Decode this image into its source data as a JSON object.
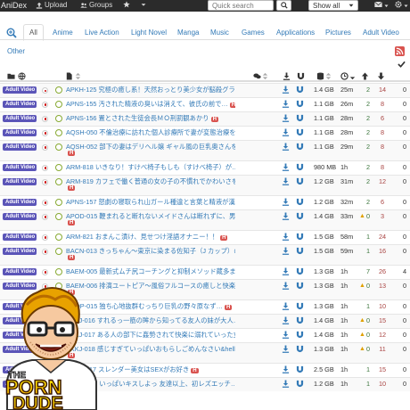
{
  "nav": {
    "brand": "AniDex",
    "upload": "Upload",
    "groups": "Groups",
    "search_placeholder": "Quick search",
    "select_value": "Show all"
  },
  "tabs": [
    "All",
    "Anime",
    "Live Action",
    "Light Novel",
    "Manga",
    "Music",
    "Games",
    "Applications",
    "Pictures",
    "Adult Video",
    "Other"
  ],
  "overlay": {
    "line1": "THE",
    "line2": "PORN",
    "line3": "DUDE"
  },
  "rows": [
    {
      "badge": "Adult Video",
      "title": "APKH-125 究極の癒し系！天然おっとり美少女が脳殺グラ・",
      "h_inline": true,
      "size": "1.4 GB",
      "age": "25m",
      "seeders": "2",
      "leechers": "14",
      "completed": "0",
      "tall": false,
      "warn": false
    },
    {
      "badge": "Adult Video",
      "title": "APNS-155 汚された精液の臭いは消えて、彼氏の前で…",
      "h_inline": true,
      "size": "1.1 GB",
      "age": "26m",
      "seeders": "2",
      "leechers": "8",
      "completed": "0",
      "tall": false,
      "warn": false
    },
    {
      "badge": "Adult Video",
      "title": "APNS-156 置とされた生徒会長ＭＯ刑罰観あかり",
      "h_inline": true,
      "size": "1.1 GB",
      "age": "28m",
      "seeders": "2",
      "leechers": "6",
      "completed": "0",
      "tall": false,
      "warn": false
    },
    {
      "badge": "Adult Video",
      "title": "AQSH-050 不倫治療に訪れた個人診療所で妻が変態治療を…",
      "h_inline": true,
      "size": "1.1 GB",
      "age": "28m",
      "seeders": "2",
      "leechers": "8",
      "completed": "0",
      "tall": false,
      "warn": false
    },
    {
      "badge": "Adult Video",
      "title": "AQSH-052 部下の妻はデリヘル嬢 ギャル風の巨乳奥さんを…",
      "h_inline": false,
      "size": "1.1 GB",
      "age": "29m",
      "seeders": "2",
      "leechers": "8",
      "completed": "0",
      "tall": true,
      "warn": false
    },
    {
      "badge": "Adult Video",
      "title": "ARM-818 いきなり！すけべ椅子もしも（すけべ椅子）が…",
      "h_inline": true,
      "size": "980 MB",
      "age": "1h",
      "seeders": "2",
      "leechers": "8",
      "completed": "0",
      "tall": false,
      "warn": false
    },
    {
      "badge": "Adult Video",
      "title": "ARM-819 カフェで働く普通の女の子の不慣れでかわいさを…",
      "h_inline": false,
      "size": "1.2 GB",
      "age": "31m",
      "seeders": "2",
      "leechers": "12",
      "completed": "0",
      "tall": true,
      "warn": false
    },
    {
      "badge": "Adult Video",
      "title": "APNS-157 怒劇の寝取られ山ガール種違と言葉と精液が漢…",
      "h_inline": true,
      "size": "1.2 GB",
      "age": "32m",
      "seeders": "2",
      "leechers": "6",
      "completed": "0",
      "tall": false,
      "warn": false
    },
    {
      "badge": "Adult Video",
      "title": "APOD-015 鞭まれると断れないメイドさんは断れずに、男…",
      "h_inline": false,
      "size": "1.4 GB",
      "age": "33m",
      "seeders": "0",
      "leechers": "3",
      "completed": "0",
      "tall": true,
      "warn": true
    },
    {
      "badge": "Adult Video",
      "title": "ARM-821 おまんこ漬け、見せつけ淫語オナニー！！",
      "h_inline": true,
      "size": "1.5 GB",
      "age": "58m",
      "seeders": "1",
      "leechers": "24",
      "completed": "0",
      "tall": false,
      "warn": false
    },
    {
      "badge": "Adult Video",
      "title": "BACN-013 きっちゃん〜東京に染まる佐知子（J カップ）の…",
      "h_inline": false,
      "size": "1.5 GB",
      "age": "59m",
      "seeders": "1",
      "leechers": "16",
      "completed": "0",
      "tall": true,
      "warn": false
    },
    {
      "badge": "Adult Video",
      "title": "BAEM-005 最新式ムチ尻コーチングと抑制メソッド蔵多まお",
      "h_inline": true,
      "size": "1.3 GB",
      "age": "1h",
      "seeders": "7",
      "leechers": "26",
      "completed": "4",
      "tall": false,
      "warn": false
    },
    {
      "badge": "Adult Video",
      "title": "BAEM-006 排演ユートピア〜風俗フルコースの癒しと快楽…",
      "h_inline": false,
      "size": "1.3 GB",
      "age": "1h",
      "seeders": "0",
      "leechers": "13",
      "completed": "0",
      "tall": true,
      "warn": true
    },
    {
      "badge": "Adult Video",
      "title": "BGDP-015 独ち心地抜群むっちり巨乳の野々原なず…",
      "h_inline": true,
      "size": "1.3 GB",
      "age": "1h",
      "seeders": "1",
      "leechers": "10",
      "completed": "0",
      "tall": false,
      "warn": false
    },
    {
      "badge": "Adult Video",
      "title": "BKKJ-016 すれるっ一筋の眸から知ってる友人の妹が大人…",
      "h_inline": true,
      "size": "1.4 GB",
      "age": "1h",
      "seeders": "0",
      "leechers": "15",
      "completed": "0",
      "tall": false,
      "warn": true
    },
    {
      "badge": "Adult Video",
      "title": "BKKJ-017 ある人の部下に姦勢されて快楽に溺れていった女…",
      "h_inline": true,
      "size": "1.4 GB",
      "age": "1h",
      "seeders": "0",
      "leechers": "12",
      "completed": "0",
      "tall": false,
      "warn": true
    },
    {
      "badge": "Adult Video",
      "title": "BKKJ-018 感じすぎていっぱいおもらしごめんなさい&hell…",
      "h_inline": false,
      "size": "1.3 GB",
      "age": "1h",
      "seeders": "0",
      "leechers": "11",
      "completed": "0",
      "tall": true,
      "warn": true
    },
    {
      "badge": "Adult Video",
      "title": "ABCF-017 スレンダー美女はSEXがお好き",
      "h_inline": true,
      "size": "2.5 GB",
      "age": "1h",
      "seeders": "1",
      "leechers": "15",
      "completed": "0",
      "tall": false,
      "warn": false
    },
    {
      "badge": "Adult Video",
      "title": "AUKG-475 いっぱいキスしよっ 友達以上、初レズエッチ…",
      "h_inline": true,
      "size": "1.2 GB",
      "age": "1h",
      "seeders": "1",
      "leechers": "10",
      "completed": "0",
      "tall": false,
      "warn": false
    }
  ],
  "colors": {
    "navbar": "#2b2b2b",
    "link": "#337ab7",
    "badge": "#5b55b8",
    "h_badge": "#d9534f",
    "seeders": "#3c763d",
    "leechers": "#a94442"
  },
  "icons": [
    "zoom-in-icon",
    "rss-icon",
    "check-icon",
    "download-icon",
    "magnet-icon",
    "search-icon",
    "envelope-icon",
    "gear-icon",
    "star-icon",
    "upload-icon",
    "users-icon"
  ]
}
